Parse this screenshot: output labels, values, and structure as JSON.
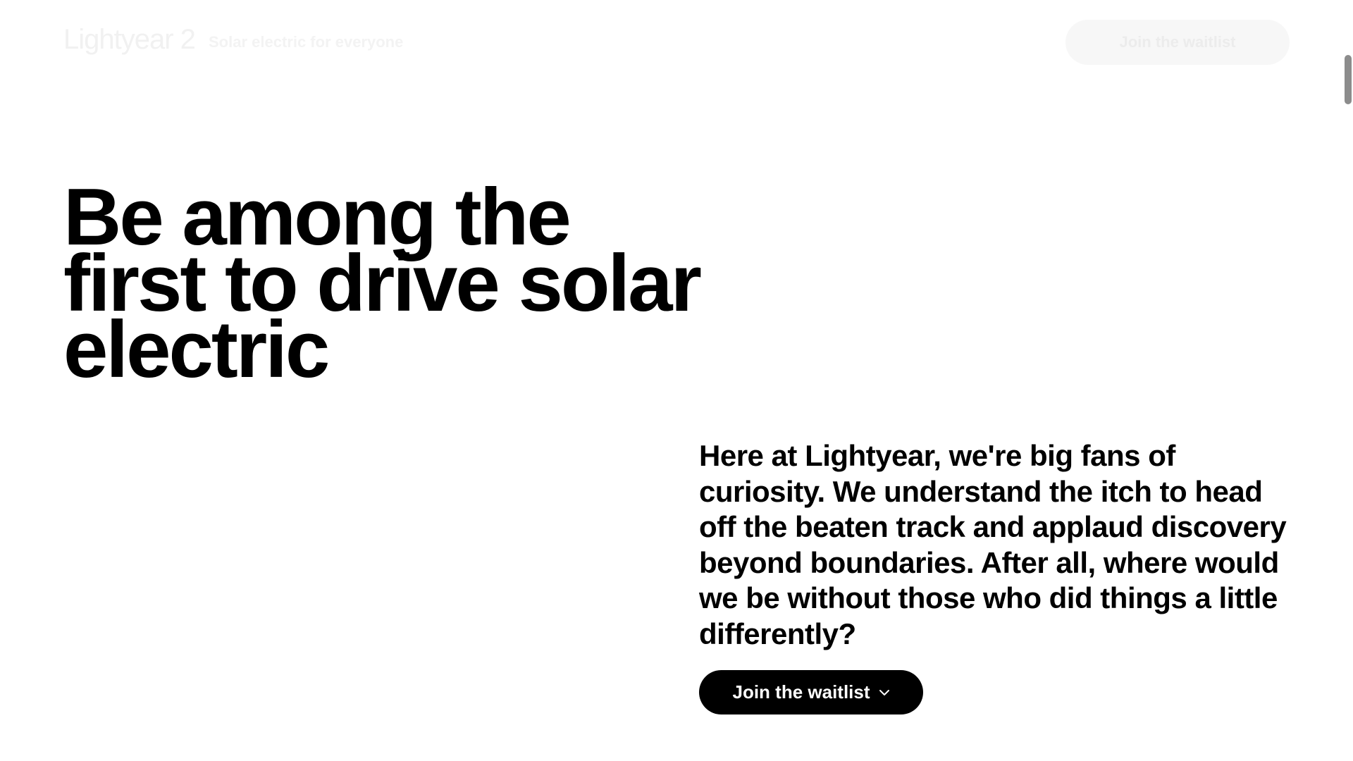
{
  "header": {
    "logo": "Lightyear 2",
    "tagline": "Solar electric for everyone",
    "cta_label": "Join the waitlist"
  },
  "hero": {
    "headline_lines": [
      "Be among the",
      "first to drive solar",
      "electric"
    ],
    "intro": "Here at Lightyear, we're big fans of curiosity. We understand the itch to head off the beaten track and applaud discovery beyond boundaries. After all, where would we be without those who did things a little differently?",
    "button_label": "Join the waitlist",
    "button_icon": "chevron-down-icon"
  },
  "colors": {
    "background": "#ffffff",
    "text": "#000000",
    "button_bg": "#000000",
    "button_text": "#ffffff"
  }
}
